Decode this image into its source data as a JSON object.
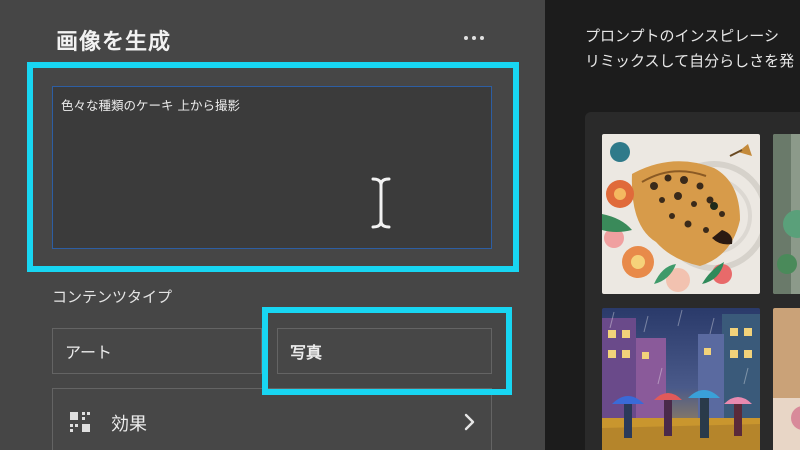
{
  "panel": {
    "title": "画像を生成",
    "more_icon": "more-horizontal-icon"
  },
  "prompt": {
    "value": "色々な種類のケーキ  上から撮影",
    "cursor_icon": "text-cursor-icon"
  },
  "content_type": {
    "label": "コンテンツタイプ",
    "options": [
      "アート",
      "写真"
    ],
    "selected": "写真"
  },
  "effects": {
    "label": "効果",
    "icon": "effects-grid-icon",
    "chevron_icon": "chevron-right-icon"
  },
  "inspiration": {
    "line1": "プロンプトのインスピレーシ",
    "line2": "リミックスして自分らしさを発"
  },
  "gallery": {
    "items": [
      "jaguar-paper-art-image",
      "rainy-street-painting-image",
      "partial-image",
      "partial-image"
    ]
  },
  "colors": {
    "highlight": "#18d6f2",
    "panel_bg": "#464646",
    "focus_border": "#2d5ea3"
  }
}
